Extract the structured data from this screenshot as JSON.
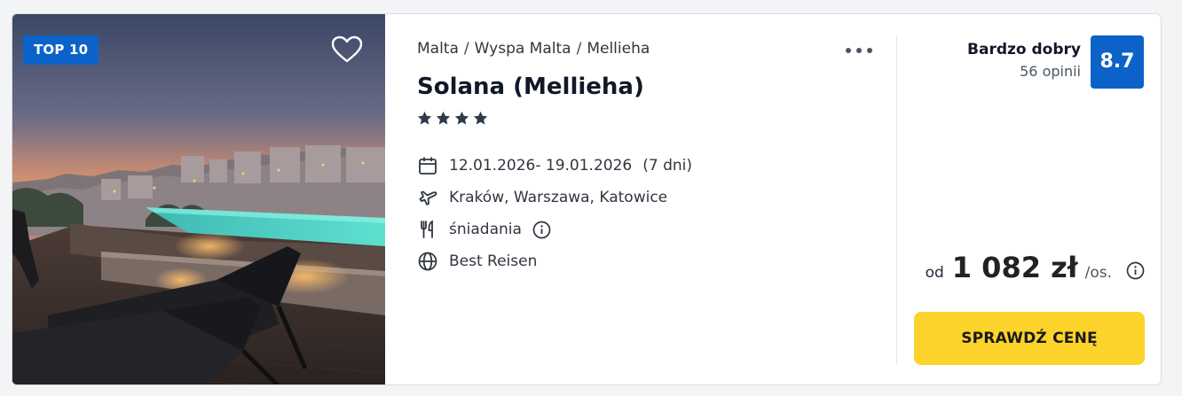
{
  "offer": {
    "badge": "TOP 10",
    "breadcrumb": [
      "Malta",
      "Wyspa Malta",
      "Mellieha"
    ],
    "breadcrumb_separator": "/",
    "hotel_name": "Solana (Mellieha)",
    "stars": 4,
    "dates": "12.01.2026- 19.01.2026",
    "duration": "(7 dni)",
    "departures": "Kraków, Warszawa, Katowice",
    "board": "śniadania",
    "operator": "Best Reisen"
  },
  "rating": {
    "label": "Bardzo dobry",
    "reviews": "56 opinii",
    "score": "8.7"
  },
  "price": {
    "prefix": "od",
    "amount": "1 082 zł",
    "suffix": "/os."
  },
  "cta": {
    "label": "SPRAWDŹ CENĘ"
  },
  "icons": {
    "favorite": "heart-outline-icon",
    "more": "more-horizontal-icon",
    "star": "star-icon",
    "dates": "calendar-icon",
    "departures": "plane-icon",
    "board": "cutlery-icon",
    "info": "info-circle-icon",
    "operator": "globe-icon"
  },
  "colors": {
    "badge_bg": "#0b63c9",
    "score_bg": "#0b63c9",
    "cta_bg": "#fcd32b",
    "star": "#2f3a4a"
  }
}
